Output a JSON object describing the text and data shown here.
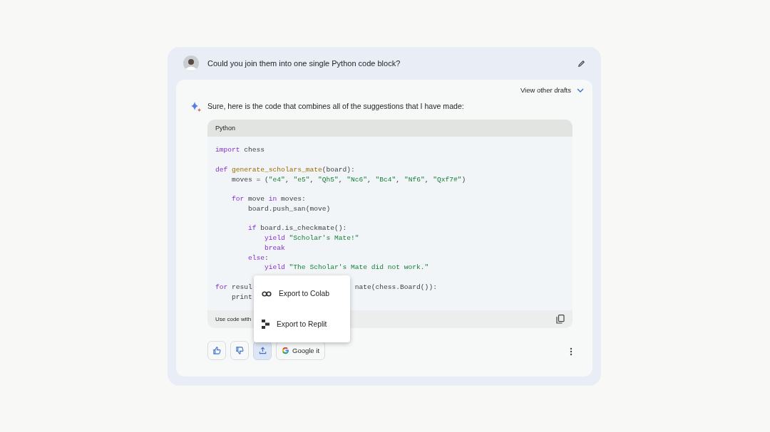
{
  "prompt": {
    "text": "Could you join them into one single Python code block?"
  },
  "response": {
    "drafts_label": "View other drafts",
    "intro": "Sure, here is the code that combines all of the suggestions that I have made:",
    "code_block": {
      "language": "Python",
      "footer": "Use code with",
      "lines": [
        {
          "tokens": [
            {
              "kind": "keyword",
              "text": "import"
            },
            {
              "kind": "plain",
              "text": " chess"
            }
          ]
        },
        {
          "blank_before": true,
          "tokens": [
            {
              "kind": "keyword",
              "text": "def"
            },
            {
              "kind": "function",
              "text": " generate_scholars_mate"
            },
            {
              "kind": "plain",
              "text": "(board):"
            }
          ],
          "children": [
            {
              "tokens": [
                {
                  "kind": "plain",
                  "text": "moves = ("
                },
                {
                  "kind": "string",
                  "text": "\"e4\""
                },
                {
                  "kind": "plain",
                  "text": ", "
                },
                {
                  "kind": "string",
                  "text": "\"e5\""
                },
                {
                  "kind": "plain",
                  "text": ", "
                },
                {
                  "kind": "string",
                  "text": "\"Qh5\""
                },
                {
                  "kind": "plain",
                  "text": ", "
                },
                {
                  "kind": "string",
                  "text": "\"Nc6\""
                },
                {
                  "kind": "plain",
                  "text": ", "
                },
                {
                  "kind": "string",
                  "text": "\"Bc4\""
                },
                {
                  "kind": "plain",
                  "text": ", "
                },
                {
                  "kind": "string",
                  "text": "\"Nf6\""
                },
                {
                  "kind": "plain",
                  "text": ", "
                },
                {
                  "kind": "string",
                  "text": "\"Qxf7#\""
                },
                {
                  "kind": "plain",
                  "text": ")"
                }
              ]
            },
            {
              "blank_before": true,
              "tokens": [
                {
                  "kind": "keyword",
                  "text": "for"
                },
                {
                  "kind": "plain",
                  "text": " move "
                },
                {
                  "kind": "keyword",
                  "text": "in"
                },
                {
                  "kind": "plain",
                  "text": " moves:"
                }
              ],
              "children": [
                {
                  "tokens": [
                    {
                      "kind": "plain",
                      "text": "board.push_san(move)"
                    }
                  ]
                },
                {
                  "blank_before": true,
                  "tokens": [
                    {
                      "kind": "keyword",
                      "text": "if"
                    },
                    {
                      "kind": "plain",
                      "text": " board.is_checkmate():"
                    }
                  ],
                  "children": [
                    {
                      "tokens": [
                        {
                          "kind": "keyword",
                          "text": "yield"
                        },
                        {
                          "kind": "string",
                          "text": " \"Scholar's Mate!\""
                        }
                      ]
                    },
                    {
                      "tokens": [
                        {
                          "kind": "keyword",
                          "text": "break"
                        }
                      ]
                    }
                  ]
                },
                {
                  "tokens": [
                    {
                      "kind": "keyword",
                      "text": "else"
                    },
                    {
                      "kind": "plain",
                      "text": ":"
                    }
                  ],
                  "children": [
                    {
                      "tokens": [
                        {
                          "kind": "keyword",
                          "text": "yield"
                        },
                        {
                          "kind": "string",
                          "text": " \"The Scholar's Mate did not work.\""
                        }
                      ]
                    }
                  ]
                }
              ]
            }
          ]
        },
        {
          "blank_before": true,
          "tokens": [
            {
              "kind": "keyword",
              "text": "for"
            },
            {
              "kind": "plain",
              "text": " resul"
            },
            {
              "kind": "covered"
            },
            {
              "kind": "plain",
              "text": "nate(chess.Board()):"
            }
          ],
          "children": [
            {
              "tokens": [
                {
                  "kind": "plain",
                  "text": "print"
                }
              ]
            }
          ]
        }
      ]
    },
    "actions": [
      {
        "kind": "thumbs-up",
        "selected": false
      },
      {
        "kind": "thumbs-down",
        "selected": false
      },
      {
        "kind": "share",
        "selected": true
      },
      {
        "kind": "google",
        "label": "Google it",
        "selected": false
      }
    ],
    "export_menu": [
      {
        "kind": "colab",
        "label": "Export to Colab"
      },
      {
        "kind": "replit",
        "label": "Export to Replit"
      }
    ]
  }
}
